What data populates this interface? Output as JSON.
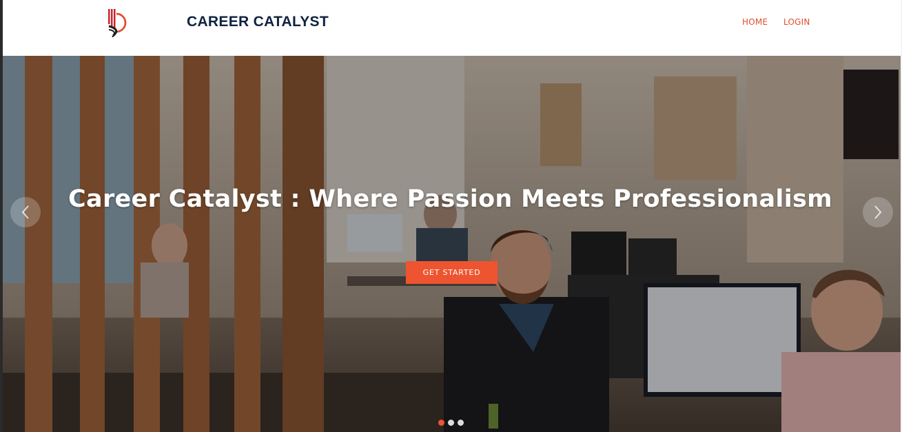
{
  "header": {
    "brand_name": "CAREER CATALYST",
    "logo_icon": "career-catalyst-logo",
    "nav": [
      {
        "label": "HOME"
      },
      {
        "label": "LOGIN"
      }
    ]
  },
  "hero": {
    "title": "Career Catalyst :  Where Passion Meets Professionalism",
    "cta_label": "GET STARTED",
    "prev_icon": "chevron-left-icon",
    "next_icon": "chevron-right-icon",
    "slide_count": 3,
    "active_slide": 1
  },
  "colors": {
    "brand_text": "#0f2240",
    "accent": "#ee5430",
    "nav_link": "#e04e2b"
  }
}
